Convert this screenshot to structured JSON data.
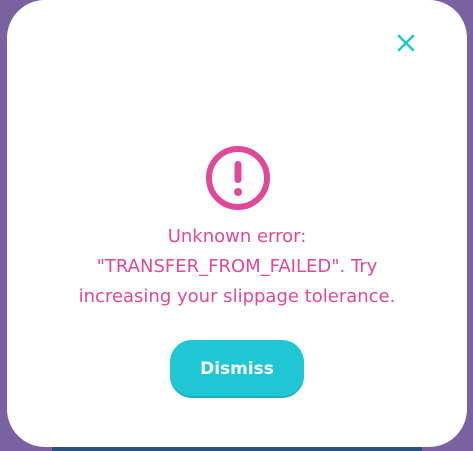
{
  "modal": {
    "error_lines": [
      "Unknown error:",
      "\"TRANSFER_FROM_FAILED\". Try",
      "increasing your slippage tolerance."
    ],
    "dismiss_label": "Dismiss",
    "close_icon": "close-icon",
    "error_icon": "error-circle-exclamation-icon"
  },
  "colors": {
    "backdrop": "#7a62a1",
    "modal_background": "#ffffff",
    "error_text": "#e0489a",
    "accent": "#1fc7d4",
    "button_text": "#ffffff"
  }
}
